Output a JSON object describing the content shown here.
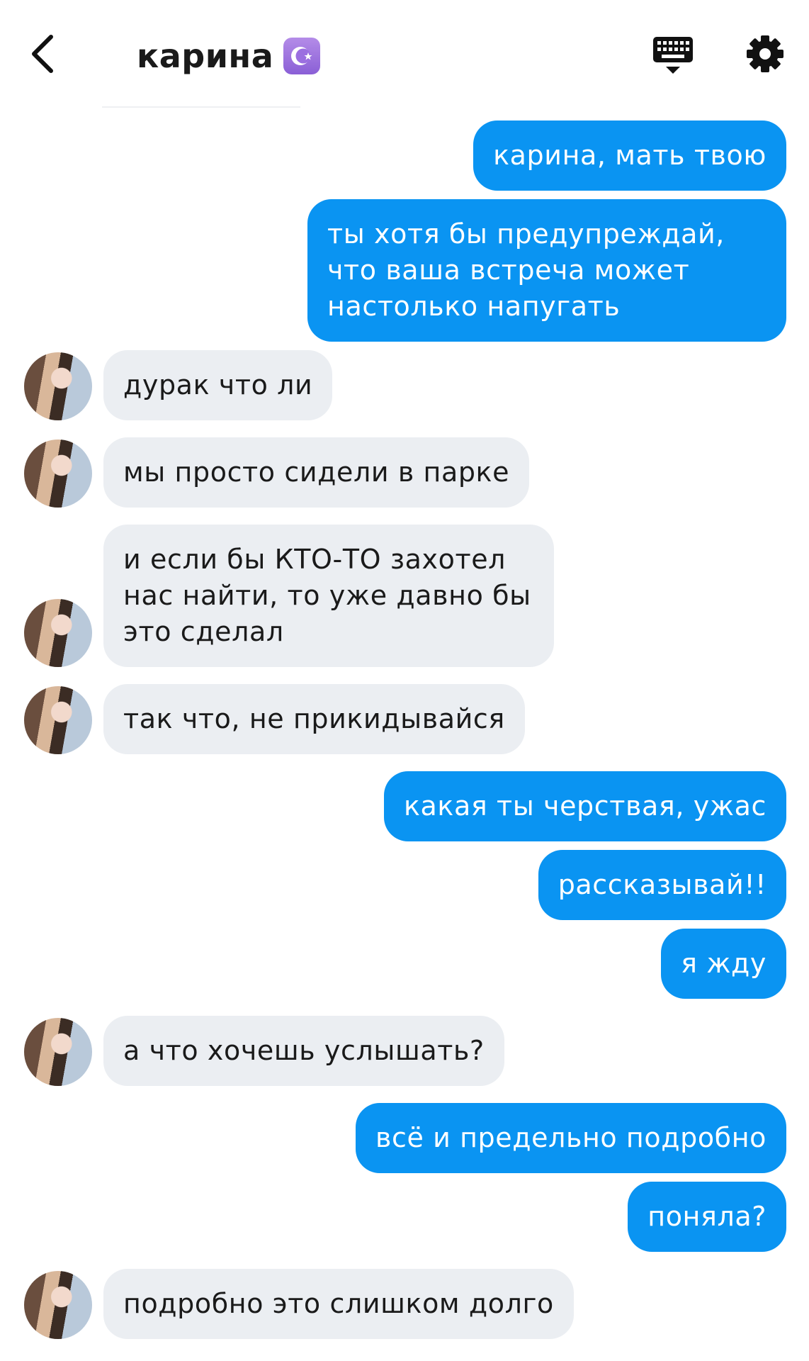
{
  "header": {
    "title": "карина",
    "title_emoji": "☪",
    "back_icon": "chevron-left-icon",
    "keyboard_icon": "keyboard-icon",
    "settings_icon": "gear-icon"
  },
  "colors": {
    "outgoing_bubble": "#0a94f2",
    "incoming_bubble": "#ebeef2",
    "emoji_badge": "#9b6fe0"
  },
  "messages": [
    {
      "dir": "out",
      "text": "карина, мать твою"
    },
    {
      "dir": "out",
      "text": "ты хотя бы предупреждай, что ваша встреча может настолько напугать"
    },
    {
      "dir": "in",
      "text": "дурак что ли"
    },
    {
      "dir": "in",
      "text": "мы просто сидели в парке"
    },
    {
      "dir": "in",
      "text": "и если бы КТО-ТО захотел нас найти, то уже давно бы это сделал"
    },
    {
      "dir": "in",
      "text": "так что, не прикидывайся"
    },
    {
      "dir": "out",
      "text": "какая ты черствая, ужас"
    },
    {
      "dir": "out",
      "text": "рассказывай!!"
    },
    {
      "dir": "out",
      "text": "я жду"
    },
    {
      "dir": "in",
      "text": "а что хочешь услышать?"
    },
    {
      "dir": "out",
      "text": "всё и предельно подробно"
    },
    {
      "dir": "out",
      "text": "поняла?"
    },
    {
      "dir": "in",
      "text": "подробно это слишком долго"
    }
  ]
}
